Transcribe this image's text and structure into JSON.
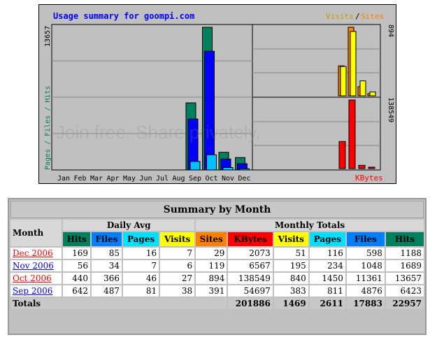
{
  "chart": {
    "title": "Usage summary for goompi.com",
    "legend_left": "Pages / Files / Hits",
    "legend_visits": "Visits",
    "legend_sep": "/",
    "legend_sites": "Sites",
    "legend_kbytes": "KBytes",
    "max_left": "13657",
    "max_visits": "894",
    "max_kbytes": "138549",
    "colors": {
      "hits": "#00805c",
      "files": "#0000ff",
      "pages": "#00c0ff",
      "visits": "#ffff00",
      "sites": "#ff8000",
      "kbytes": "#ff0000"
    }
  },
  "chart_data": {
    "type": "bar",
    "categories": [
      "Jan",
      "Feb",
      "Mar",
      "Apr",
      "May",
      "Jun",
      "Jul",
      "Aug",
      "Sep",
      "Oct",
      "Nov",
      "Dec"
    ],
    "series": [
      {
        "name": "Hits",
        "values": [
          0,
          0,
          0,
          0,
          0,
          0,
          0,
          0,
          6423,
          13657,
          1689,
          1188
        ]
      },
      {
        "name": "Files",
        "values": [
          0,
          0,
          0,
          0,
          0,
          0,
          0,
          0,
          4876,
          11361,
          1048,
          598
        ]
      },
      {
        "name": "Pages",
        "values": [
          0,
          0,
          0,
          0,
          0,
          0,
          0,
          0,
          811,
          1450,
          234,
          116
        ]
      },
      {
        "name": "Visits",
        "values": [
          0,
          0,
          0,
          0,
          0,
          0,
          0,
          0,
          383,
          840,
          195,
          51
        ]
      },
      {
        "name": "Sites",
        "values": [
          0,
          0,
          0,
          0,
          0,
          0,
          0,
          0,
          391,
          894,
          119,
          29
        ]
      },
      {
        "name": "KBytes",
        "values": [
          0,
          0,
          0,
          0,
          0,
          0,
          0,
          0,
          54697,
          138549,
          6567,
          2073
        ]
      }
    ]
  },
  "table": {
    "title": "Summary by Month",
    "month_label": "Month",
    "daily_avg": "Daily Avg",
    "monthly_totals": "Monthly Totals",
    "headers": [
      "Hits",
      "Files",
      "Pages",
      "Visits",
      "Sites",
      "KBytes",
      "Visits",
      "Pages",
      "Files",
      "Hits"
    ],
    "header_colors": [
      "#00805c",
      "#0080ff",
      "#00e0ff",
      "#ffff00",
      "#ff8000",
      "#ff0000",
      "#ffff00",
      "#00e0ff",
      "#0080ff",
      "#00805c"
    ],
    "header_text_colors": [
      "#000000",
      "#000000",
      "#000000",
      "#000000",
      "#000000",
      "#000000",
      "#000000",
      "#000000",
      "#000000",
      "#000000"
    ],
    "rows": [
      {
        "month": "Dec 2006",
        "link_color": "#ff0000",
        "values": [
          "169",
          "85",
          "16",
          "7",
          "29",
          "2073",
          "51",
          "116",
          "598",
          "1188"
        ]
      },
      {
        "month": "Nov 2006",
        "link_color": "#0000ff",
        "values": [
          "56",
          "34",
          "7",
          "6",
          "119",
          "6567",
          "195",
          "234",
          "1048",
          "1689"
        ]
      },
      {
        "month": "Oct 2006",
        "link_color": "#ff0000",
        "values": [
          "440",
          "366",
          "46",
          "27",
          "894",
          "138549",
          "840",
          "1450",
          "11361",
          "13657"
        ]
      },
      {
        "month": "Sep 2006",
        "link_color": "#0000ff",
        "values": [
          "642",
          "487",
          "81",
          "38",
          "391",
          "54697",
          "383",
          "811",
          "4876",
          "6423"
        ]
      }
    ],
    "totals_label": "Totals",
    "totals": [
      "201886",
      "1469",
      "2611",
      "17883",
      "22957"
    ]
  },
  "watermark": {
    "line": "Join free. Share privately."
  }
}
